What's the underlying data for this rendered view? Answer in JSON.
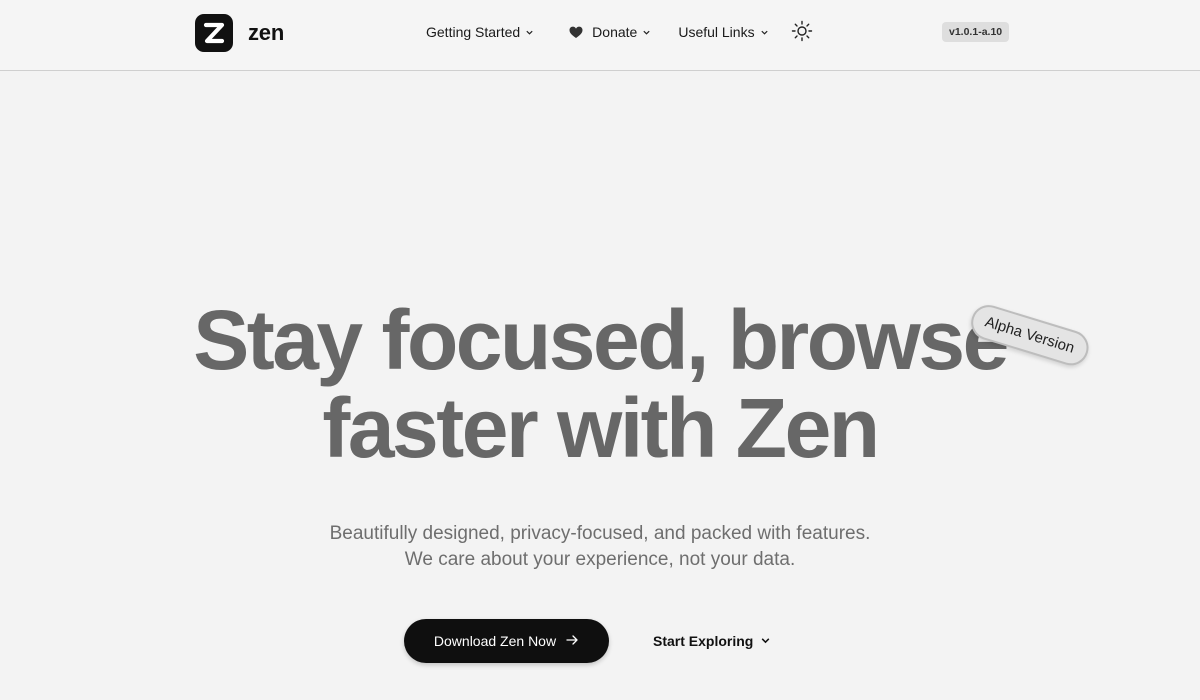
{
  "header": {
    "brand": "zen",
    "logo_icon": "zen-z-logo",
    "nav": [
      {
        "label": "Getting Started",
        "icon": "chevron-down-icon"
      },
      {
        "label": "Donate",
        "icon": "heart-icon"
      },
      {
        "label": "Useful Links",
        "icon": "chevron-down-icon"
      }
    ],
    "theme_toggle_icon": "sun-icon",
    "version": "v1.0.1-a.10"
  },
  "hero": {
    "title_line1": "Stay focused, browse",
    "title_line2": "faster with Zen",
    "badge": "Alpha Version",
    "subtitle_line1": "Beautifully designed, privacy-focused, and packed with features.",
    "subtitle_line2": "We care about your experience, not your data.",
    "primary_button": "Download Zen Now",
    "secondary_button": "Start Exploring"
  },
  "colors": {
    "background": "#f3f3f3",
    "title_gray": "#676767",
    "primary_button_bg": "#0f0f0f",
    "badge_bg": "#dedede"
  }
}
